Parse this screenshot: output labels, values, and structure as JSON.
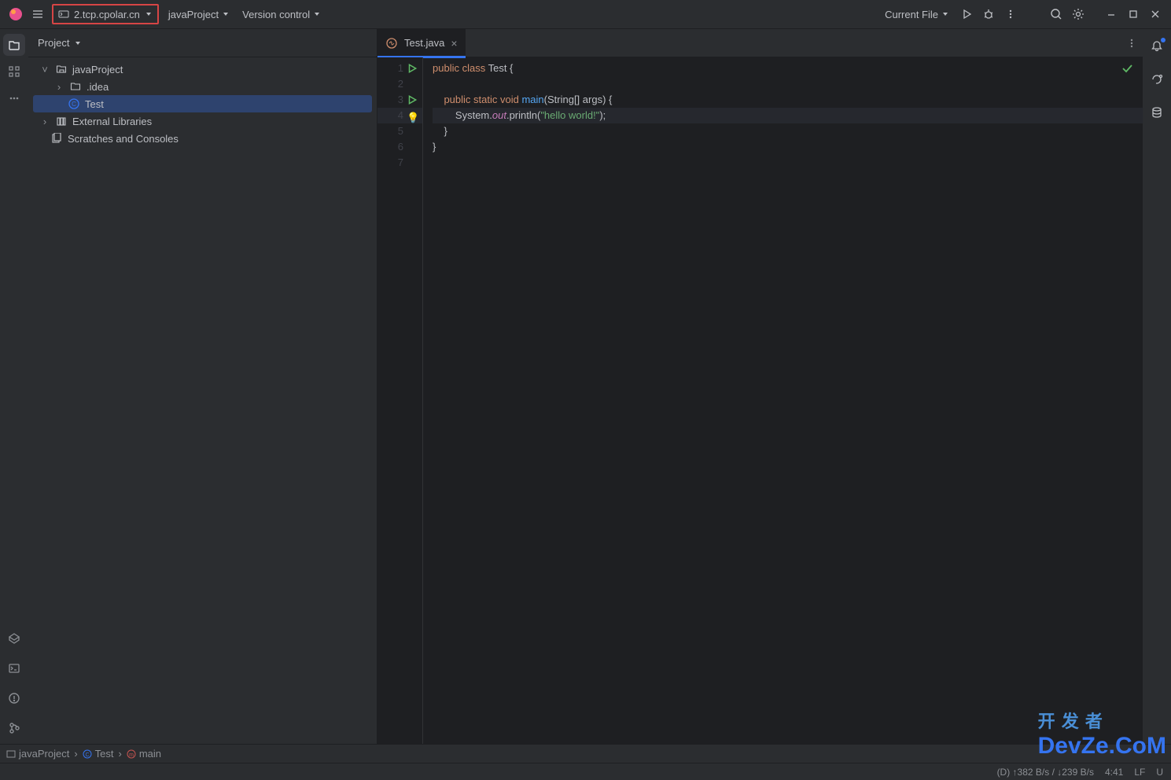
{
  "toolbar": {
    "host": "2.tcp.cpolar.cn",
    "project": "javaProject",
    "vcs": "Version control",
    "runconfig": "Current File"
  },
  "sidebar": {
    "title": "Project",
    "items": [
      {
        "label": "javaProject"
      },
      {
        "label": ".idea"
      },
      {
        "label": "Test"
      },
      {
        "label": "External Libraries"
      },
      {
        "label": "Scratches and Consoles"
      }
    ]
  },
  "editor": {
    "tab": "Test.java",
    "gutters": [
      "1",
      "2",
      "3",
      "4",
      "5",
      "6",
      "7"
    ],
    "code": {
      "l1_kw1": "public",
      "l1_kw2": "class",
      "l1_name": " Test {",
      "l3_kw": "public static void",
      "l3_fn": "main",
      "l3_rest": "(String[] args) {",
      "l4_pre": "System.",
      "l4_fld": "out",
      "l4_call": ".println(",
      "l4_str": "\"hello world!\"",
      "l4_end": ");",
      "l5": "        }",
      "l6": "}"
    }
  },
  "breadcrumbs": [
    {
      "label": "javaProject"
    },
    {
      "label": "Test"
    },
    {
      "label": "main"
    }
  ],
  "status": {
    "net": "(D) ↑382 B/s / ↓239 B/s",
    "pos": "4:41",
    "lf": "LF",
    "enc": "U"
  },
  "watermark1": "开 发 者",
  "watermark2": "DevZe.CoM"
}
